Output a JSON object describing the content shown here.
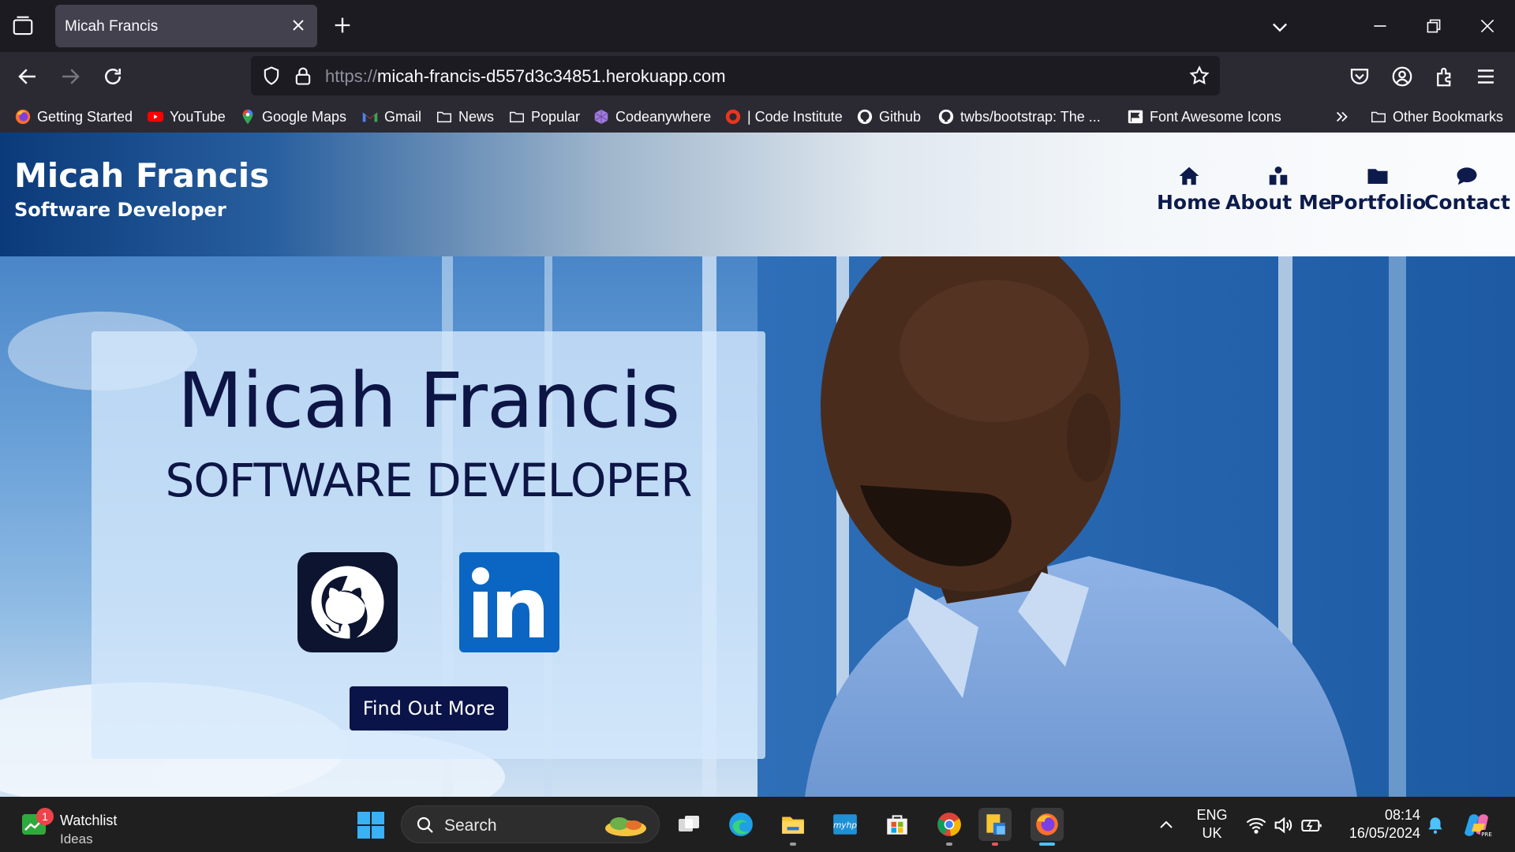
{
  "browser": {
    "tab": {
      "title": "Micah Francis"
    },
    "url": {
      "protocol": "https://",
      "host": "micah-francis-d557d3c34851.herokuapp.com"
    },
    "bookmarks": [
      {
        "label": "Getting Started",
        "icon": "firefox-icon"
      },
      {
        "label": "YouTube",
        "icon": "youtube-icon"
      },
      {
        "label": "Google Maps",
        "icon": "maps-pin-icon"
      },
      {
        "label": "Gmail",
        "icon": "gmail-icon"
      },
      {
        "label": "News",
        "icon": "folder-icon"
      },
      {
        "label": "Popular",
        "icon": "folder-icon"
      },
      {
        "label": "Codeanywhere",
        "icon": "codeanywhere-icon"
      },
      {
        "label": "| Code Institute",
        "icon": "code-institute-icon"
      },
      {
        "label": "Github",
        "icon": "github-icon"
      },
      {
        "label": "twbs/bootstrap: The ...",
        "icon": "github-icon"
      },
      {
        "label": "Font Awesome Icons",
        "icon": "flag-icon"
      }
    ],
    "other_bookmarks": "Other Bookmarks"
  },
  "site": {
    "brand_title": "Micah Francis",
    "brand_subtitle": "Software Developer",
    "nav": [
      {
        "label": "Home",
        "icon": "home-icon"
      },
      {
        "label": "About Me",
        "icon": "user-icon"
      },
      {
        "label": "Portfolio",
        "icon": "folder-icon"
      },
      {
        "label": "Contact",
        "icon": "chat-bubble-icon"
      }
    ],
    "hero": {
      "name": "Micah Francis",
      "role": "SOFTWARE DEVELOPER",
      "cta": "Find Out More",
      "social": [
        "github-icon",
        "linkedin-icon"
      ]
    }
  },
  "taskbar": {
    "widget": {
      "title": "Watchlist",
      "subtitle": "Ideas",
      "badge": "1"
    },
    "search_label": "Search",
    "language": {
      "line1": "ENG",
      "line2": "UK"
    },
    "clock": {
      "time": "08:14",
      "date": "16/05/2024"
    }
  },
  "colors": {
    "brand_navy": "#0d1545",
    "cta_bg": "#0b1448",
    "linkedin_blue": "#0a66c2",
    "tab_bg": "#42414d",
    "toolbar_bg": "#2b2a33"
  }
}
